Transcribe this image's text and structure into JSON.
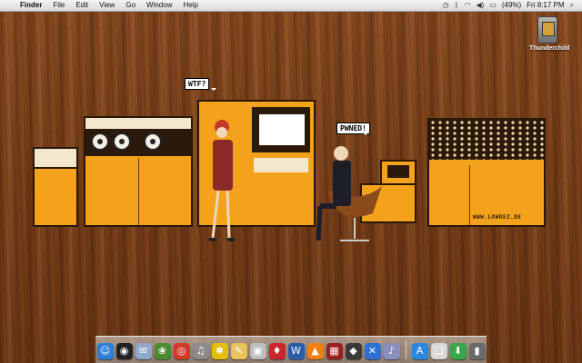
{
  "menubar": {
    "apple_icon": "apple-icon",
    "app_name": "Finder",
    "menus": [
      "File",
      "Edit",
      "View",
      "Go",
      "Window",
      "Help"
    ],
    "battery_text": "(49%)",
    "clock": "Fri 8:17 PM"
  },
  "desktop": {
    "drive_label": "Thunderchild"
  },
  "wallpaper": {
    "bubble_left": "WTF?",
    "bubble_right": "PWNED!",
    "credit": "WWW.LOWREZ.DE"
  },
  "dock": {
    "items": [
      {
        "name": "finder-icon",
        "glyph": "☺",
        "color": "#2d7fd6"
      },
      {
        "name": "dashboard-icon",
        "glyph": "◉",
        "color": "#222222"
      },
      {
        "name": "mail-icon",
        "glyph": "✉",
        "color": "#8fa8c8"
      },
      {
        "name": "iphoto-icon",
        "glyph": "❀",
        "color": "#4c8a2e"
      },
      {
        "name": "chrome-icon",
        "glyph": "◎",
        "color": "#d23a2a"
      },
      {
        "name": "itunes-icon",
        "glyph": "♫",
        "color": "#8c8c8c"
      },
      {
        "name": "pinwheel-icon",
        "glyph": "✱",
        "color": "#e0c000"
      },
      {
        "name": "notes-icon",
        "glyph": "✎",
        "color": "#e8c45a"
      },
      {
        "name": "preview-icon",
        "glyph": "▣",
        "color": "#bdbdbd"
      },
      {
        "name": "app-red-icon",
        "glyph": "♦",
        "color": "#c8282c"
      },
      {
        "name": "word-icon",
        "glyph": "W",
        "color": "#2a5caa"
      },
      {
        "name": "vlc-icon",
        "glyph": "▲",
        "color": "#f08010"
      },
      {
        "name": "photo-booth-icon",
        "glyph": "▦",
        "color": "#9a2020"
      },
      {
        "name": "app-dark-icon",
        "glyph": "◆",
        "color": "#3a3a3a"
      },
      {
        "name": "xcode-icon",
        "glyph": "✕",
        "color": "#2f6fd0"
      },
      {
        "name": "music-icon",
        "glyph": "♪",
        "color": "#8a8fbd"
      },
      {
        "name": "app-store-icon",
        "glyph": "A",
        "color": "#2a88e0"
      },
      {
        "name": "documents-icon",
        "glyph": "❑",
        "color": "#d9d9d9"
      },
      {
        "name": "downloads-icon",
        "glyph": "⬇",
        "color": "#3aa84a"
      },
      {
        "name": "trash-icon",
        "glyph": "▮",
        "color": "#6a6a6a"
      }
    ]
  }
}
